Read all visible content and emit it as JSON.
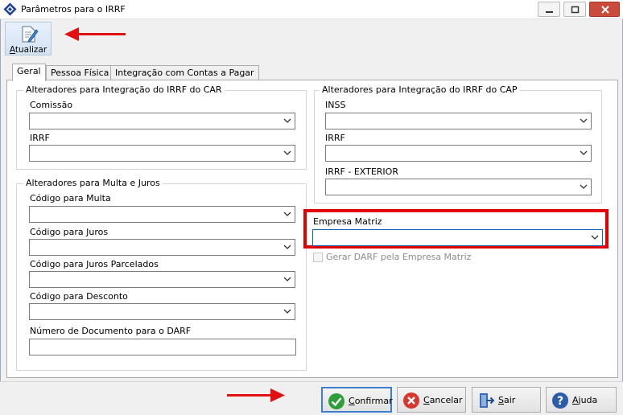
{
  "window": {
    "title": "Parâmetros para o IRRF"
  },
  "toolbar": {
    "update_label_first": "A",
    "update_label_rest": "tualizar"
  },
  "tabs": [
    {
      "label": "Geral",
      "active": true
    },
    {
      "label": "Pessoa Física",
      "active": false
    },
    {
      "label": "Integração com Contas a Pagar",
      "active": false
    }
  ],
  "car_group": {
    "title": "Alteradores para Integração do IRRF do CAR",
    "fields": [
      {
        "label": "Comissão",
        "value": ""
      },
      {
        "label": "IRRF",
        "value": ""
      }
    ]
  },
  "cap_group": {
    "title": "Alteradores para Integração do IRRF do CAP",
    "fields": [
      {
        "label": "INSS",
        "value": ""
      },
      {
        "label": "IRRF",
        "value": ""
      },
      {
        "label": "IRRF - EXTERIOR",
        "value": ""
      }
    ]
  },
  "multa_group": {
    "title": "Alteradores para Multa e Juros",
    "fields": [
      {
        "label": "Código para Multa",
        "value": ""
      },
      {
        "label": "Código para Juros",
        "value": ""
      },
      {
        "label": "Código para Juros Parcelados",
        "value": ""
      },
      {
        "label": "Código para Desconto",
        "value": ""
      }
    ],
    "doc_label": "Número de Documento para o DARF",
    "doc_value": ""
  },
  "empresa_matriz": {
    "label": "Empresa Matriz",
    "value": ""
  },
  "gerar_darf": {
    "label": "Gerar DARF pela Empresa Matriz",
    "checked": false,
    "enabled": false
  },
  "buttons": {
    "confirm_first": "C",
    "confirm_rest": "onfirmar",
    "cancel_first": "C",
    "cancel_rest": "ancelar",
    "exit_first": "S",
    "exit_rest": "air",
    "help_first": "A",
    "help_rest": "juda"
  },
  "colors": {
    "annotation_red": "#e00000",
    "focus_blue": "#0a64c0"
  }
}
